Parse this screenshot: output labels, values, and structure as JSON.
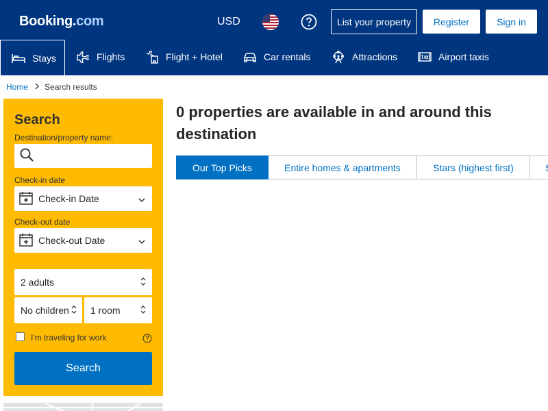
{
  "header": {
    "logo_main": "Booking",
    "logo_dot": ".",
    "logo_com": "com",
    "currency": "USD",
    "list_property": "List your property",
    "register": "Register",
    "sign_in": "Sign in",
    "icons": {
      "flag": "us-flag-icon",
      "help": "question-circle-icon"
    }
  },
  "nav": {
    "items": [
      {
        "label": "Stays",
        "icon": "bed-icon"
      },
      {
        "label": "Flights",
        "icon": "plane-icon"
      },
      {
        "label": "Flight + Hotel",
        "icon": "plane-hotel-icon"
      },
      {
        "label": "Car rentals",
        "icon": "car-icon"
      },
      {
        "label": "Attractions",
        "icon": "attractions-icon"
      },
      {
        "label": "Airport taxis",
        "icon": "taxi-icon"
      }
    ]
  },
  "breadcrumb": {
    "home": "Home",
    "current": "Search results"
  },
  "search": {
    "title": "Search",
    "destination_label": "Destination/property name:",
    "destination_value": "",
    "checkin_label": "Check-in date",
    "checkin_value": "Check-in Date",
    "checkout_label": "Check-out date",
    "checkout_value": "Check-out Date",
    "adults": "2 adults",
    "children": "No children",
    "rooms": "1 room",
    "work_label": "I'm traveling for work",
    "button": "Search"
  },
  "results": {
    "headline": "0 properties are available in and around this destination",
    "sort_tabs": [
      {
        "label": "Our Top Picks",
        "active": true
      },
      {
        "label": "Entire homes & apartments",
        "active": false
      },
      {
        "label": "Stars (highest first)",
        "active": false
      },
      {
        "label": "S",
        "active": false
      }
    ]
  },
  "colors": {
    "brand_blue": "#003580",
    "accent_blue": "#0071c2",
    "search_yellow": "#febb02"
  }
}
